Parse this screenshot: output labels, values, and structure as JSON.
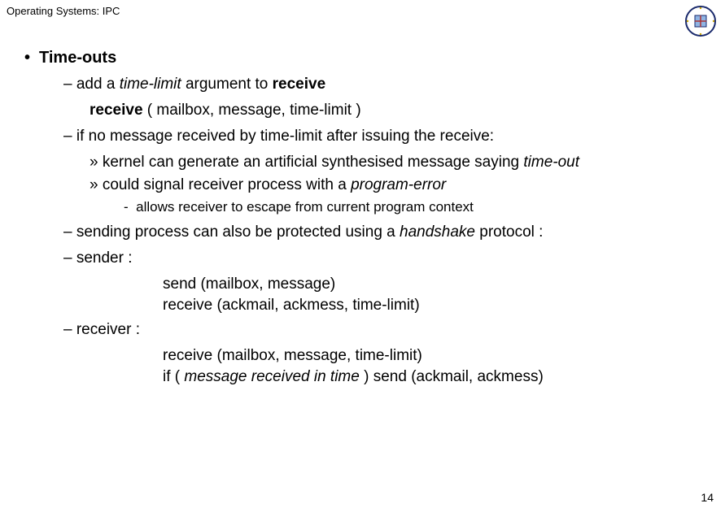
{
  "header": {
    "title": "Operating Systems: IPC"
  },
  "crest": {
    "name": "university-crest"
  },
  "slide": {
    "heading_bullet": "•",
    "heading": "Time-outs",
    "l2a_dash": "–",
    "l2a_pre": "add a ",
    "l2a_ital": "time-limit",
    "l2a_mid": " argument to ",
    "l2a_bold": "receive",
    "recv_sig_bold": "receive",
    "recv_sig_rest": " ( mailbox, message, time-limit )",
    "l2b_dash": "–",
    "l2b_text": "if no message received by time-limit after issuing the receive:",
    "l3a_dq": "»",
    "l3a_pre": "kernel can generate an artificial synthesised message saying ",
    "l3a_ital": "time-out",
    "l3b_dq": "»",
    "l3b_pre": "could signal receiver process with a ",
    "l3b_ital": "program-error",
    "l4_dash": "-",
    "l4_text": "allows receiver to escape from current program context",
    "l2c_dash": "–",
    "l2c_pre": "sending process can also be protected using a ",
    "l2c_ital": "handshake",
    "l2c_post": " protocol :",
    "l2d_dash": "–",
    "l2d_text": "sender :",
    "sender_send": "send (mailbox, message)",
    "sender_recv": "receive (ackmail, ackmess, time-limit)",
    "l2e_dash": "–",
    "l2e_text": "receiver :",
    "recv_recv": "receive (mailbox, message, time-limit)",
    "recv_if_pre": "if ( ",
    "recv_if_ital": "message received in time",
    "recv_if_post": " ) send (ackmail, ackmess)"
  },
  "page_number": "14"
}
